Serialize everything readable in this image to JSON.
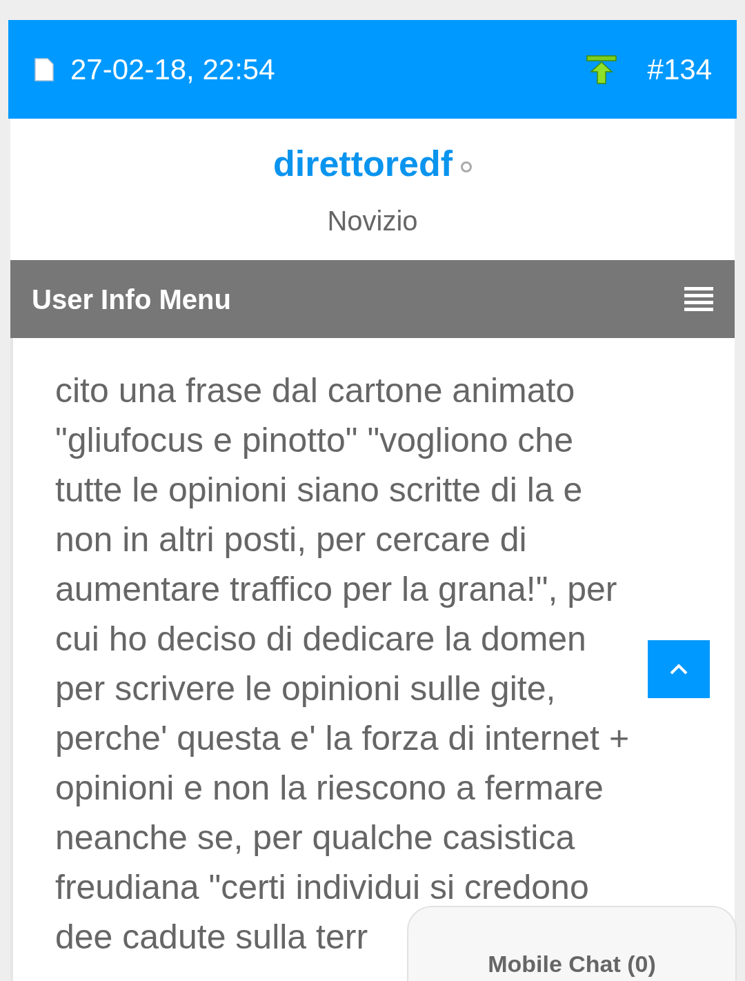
{
  "post_header": {
    "date": "27-02-18, 22:54",
    "post_number": "#134"
  },
  "author": {
    "username": "direttoredf",
    "online": false,
    "rank": "Novizio"
  },
  "user_menu": {
    "title": "User Info Menu"
  },
  "post_lines": [
    "cito una frase dal cartone animato",
    "\"gliufocus e pinotto\" \"vogliono che",
    "tutte le opinioni siano scritte di la e",
    "non in altri posti, per cercare di",
    "aumentare traffico per la grana!\", per",
    "cui ho deciso di dedicare la domen",
    "per scrivere le opinioni sulle gite,",
    "perche' questa e' la forza di internet +",
    "opinioni e non la riescono a fermare",
    "neanche se, per qualche casistica",
    "freudiana \"certi individui si credono",
    "dee cadute sulla terr"
  ],
  "chat_panel": {
    "label": "Mobile Chat (0)"
  }
}
